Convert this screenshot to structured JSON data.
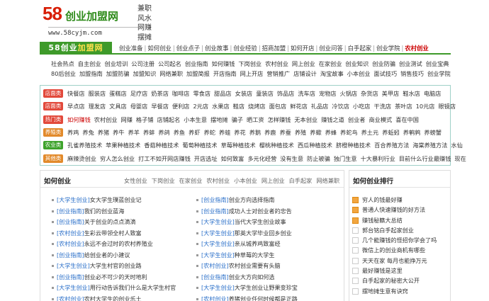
{
  "header": {
    "logo_num": "58",
    "logo_text": "创业加盟网",
    "url": "www.58cyjm.com",
    "slogans": [
      "兼职",
      "风水",
      "网赚",
      "摆摊"
    ]
  },
  "nav": {
    "brand_a": "58创业",
    "brand_b": "加盟网",
    "items": [
      {
        "label": "创业准备",
        "hl": false
      },
      {
        "label": "如何创业",
        "hl": false
      },
      {
        "label": "创业点子",
        "hl": false
      },
      {
        "label": "创业故事",
        "hl": false
      },
      {
        "label": "创业经验",
        "hl": false
      },
      {
        "label": "招商加盟",
        "hl": false
      },
      {
        "label": "如何开店",
        "hl": false
      },
      {
        "label": "创业问答",
        "hl": false
      },
      {
        "label": "白手起家",
        "hl": false
      },
      {
        "label": "创业学院",
        "hl": false
      },
      {
        "label": "农村创业",
        "hl": true
      }
    ]
  },
  "sub": [
    [
      "社会热点",
      "自主创业",
      "创业培训",
      "公司注册",
      "公司起名",
      "创业指南",
      "如何赚钱",
      "下岗创业",
      "农村创业",
      "网上创业",
      "在家创业",
      "创业知识",
      "创业防骗",
      "创业测试",
      "创业宝典"
    ],
    [
      "80后创业",
      "加盟指南",
      "加盟防骗",
      "加盟知识",
      "网络兼职",
      "加盟简报",
      "开店指南",
      "网上开店",
      "营销推广",
      "店铺设计",
      "淘宝故事",
      "小本创业",
      "面试技巧",
      "销售技巧",
      "创业学院"
    ]
  ],
  "tags": [
    {
      "label": "店面类",
      "color": "#e2493b",
      "links": [
        "快餐店",
        "服装店",
        "蛋糕店",
        "足疗店",
        "奶茶店",
        "咖啡店",
        "零食店",
        "甜品店",
        "女装店",
        "童装店",
        "饰品店",
        "洗车店",
        "宠物店",
        "火锅店",
        "杂货店",
        "美甲店",
        "鞋水店",
        "电脑店"
      ],
      "red": []
    },
    {
      "label": "店面类",
      "color": "#e2493b",
      "links": [
        "早点店",
        "理发店",
        "文具店",
        "母婴店",
        "早餐店",
        "便利店",
        "2元店",
        "水果店",
        "鞋店",
        "烧烤店",
        "面包店",
        "鲜花店",
        "礼品店",
        "冷饮店",
        "小吃店",
        "干洗店",
        "茶叶店",
        "10元店",
        "眼镜店"
      ],
      "red": []
    },
    {
      "label": "热门类",
      "color": "#e2493b",
      "links": [
        "如何赚钱",
        "农村创业",
        "网赚",
        "格子铺",
        "店铺起名",
        "小本生意",
        "摆地摊",
        "骗子",
        "晒工资",
        "怎样赚钱",
        "无本创业",
        "赚钱之道",
        "创业者",
        "商业模式",
        "喜在中国"
      ],
      "red": [
        "如何赚钱"
      ]
    },
    {
      "label": "养殖类",
      "color": "#e28a2b",
      "links": [
        "养鸡",
        "养兔",
        "养猪",
        "养牛",
        "养羊",
        "养蚌",
        "养鸽",
        "养鱼",
        "养虾",
        "养蛇",
        "养蛙",
        "养花",
        "养鹅",
        "养鹿",
        "养蚕",
        "养殖",
        "养蠍",
        "养蜂",
        "养蛇鸟",
        "养土元",
        "养蚯蚓",
        "养鹌鹑",
        "养螃蟹"
      ],
      "red": []
    },
    {
      "label": "农业类",
      "color": "#3ea32c",
      "links": [
        "孔雀养殖技术",
        "苹果种植技术",
        "香菇种植技术",
        "葡萄种植技术",
        "草莓种植技术",
        "樱桃种植技术",
        "西瓜种植技术",
        "脐橙种植技术",
        "百合养殖方法",
        "海棠养殖方法",
        "水仙"
      ],
      "red": []
    },
    {
      "label": "其他类",
      "color": "#e28a2b",
      "links": [
        "麻辣烫创业",
        "穷人怎么创业",
        "打工不如开网店赚钱",
        "开店选址",
        "如何致富",
        "多元化经营",
        "没有生意",
        "防止被骗",
        "独门生意",
        "十大暴利行业",
        "目前什么行业最赚钱",
        "现在"
      ],
      "red": []
    }
  ],
  "left_panel": {
    "title": "如何创业",
    "tabs": [
      "女性创业",
      "下岗创业",
      "在家创业",
      "农村创业",
      "小本创业",
      "网上创业",
      "白手起家",
      "网络兼职"
    ],
    "col1": [
      {
        "cat": "[大学生创业]",
        "title": "女大学生璞蓝创业记"
      },
      {
        "cat": "[创业指南]",
        "title": "我们的创业蓝海"
      },
      {
        "cat": "[创业指南]",
        "title": "关于创业的点点滴滴"
      },
      {
        "cat": "[农村创业]",
        "title": "生彩云带领全村人致富"
      },
      {
        "cat": "[农村创业]",
        "title": "永远不会过时的农村养殖业"
      },
      {
        "cat": "[创业指南]",
        "title": "给创业者的小建议"
      },
      {
        "cat": "[大学生创业]",
        "title": "大学生村官的创业路"
      },
      {
        "cat": "[创业指南]",
        "title": "创业必不可少的天时地利"
      },
      {
        "cat": "[大学生创业]",
        "title": "用行动告诉我们什么是大学生村官"
      },
      {
        "cat": "[农村创业]",
        "title": "农村大学生的创业乐土"
      }
    ],
    "col2": [
      {
        "cat": "[创业指南]",
        "title": "创业方向选择指南"
      },
      {
        "cat": "[创业指南]",
        "title": "成功人士对创业者的忠告"
      },
      {
        "cat": "[大学生创业]",
        "title": "当代大学生创业故事"
      },
      {
        "cat": "[大学生创业]",
        "title": "那英大学毕业回乡创业"
      },
      {
        "cat": "[大学生创业]",
        "title": "亲从城养鸡致富经"
      },
      {
        "cat": "[大学生创业]",
        "title": "种草莓的大学生"
      },
      {
        "cat": "[农村创业]",
        "title": "农村创业需要有头脑"
      },
      {
        "cat": "[创业指南]",
        "title": "创业大方向如何选"
      },
      {
        "cat": "[大学生创业]",
        "title": "大学生创业让野果变珍宝"
      },
      {
        "cat": "[农村创业]",
        "title": "养猪创业任何时候都是正路"
      }
    ]
  },
  "right_panel": {
    "title": "如何创业排行",
    "items": [
      "穷人的钱最好赚",
      "普通人快速赚钱的好方法",
      "赚钱秘籍大总结",
      "郭台铭白手起家创业",
      "几个能赚钱的怪招你学会了吗",
      "微信上的创业商机有哪些",
      "天天在家 每月也能挣万元",
      "最好赚钱是这里",
      "白手起家的秘密大公开",
      "摆地摊生意有诀窍"
    ]
  },
  "colors": {
    "brand_green": "#3e9a2a",
    "brand_red": "#d81e06",
    "link_blue": "#2a6fc9",
    "border_teal": "#9fd0c8"
  }
}
